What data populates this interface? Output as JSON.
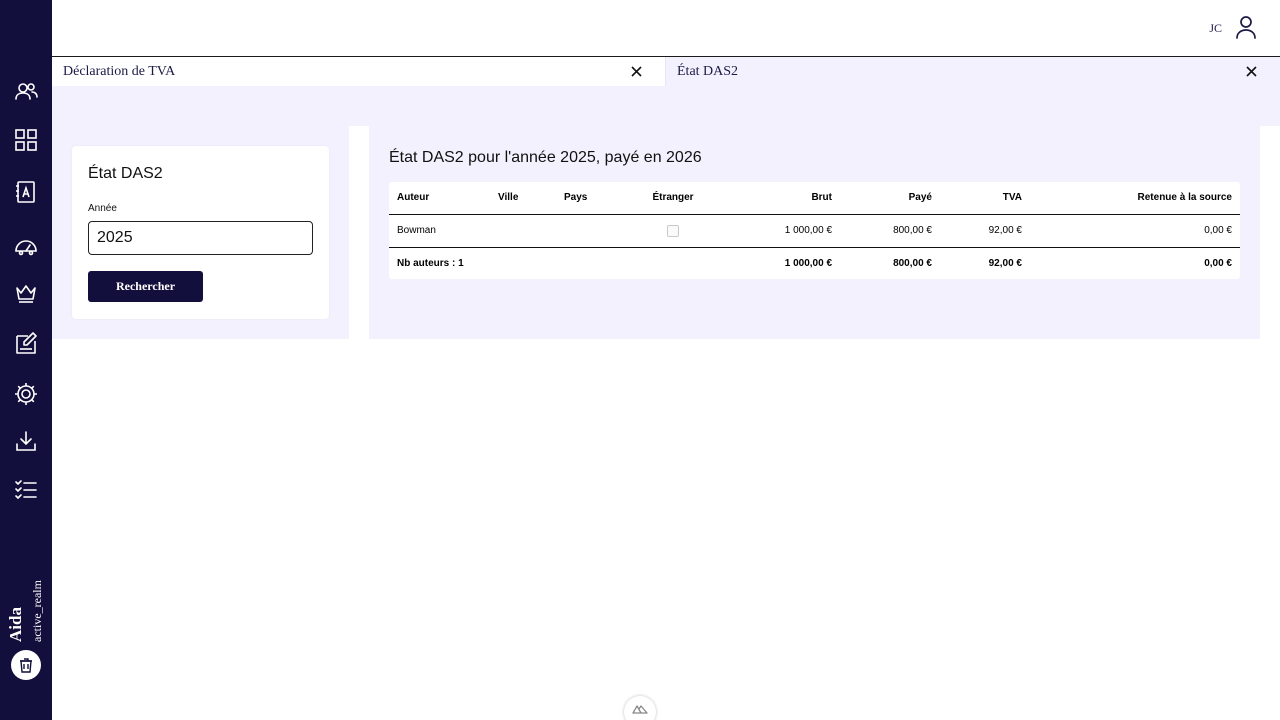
{
  "app": {
    "brand_name": "Aida",
    "realm": "active_realm"
  },
  "header": {
    "user_initials": "JC"
  },
  "sidebar": {
    "icons": [
      "users-icon",
      "dashboard-grid-icon",
      "contacts-book-icon",
      "gauge-icon",
      "crown-icon",
      "edit-document-icon",
      "gear-icon",
      "download-icon",
      "checklist-icon"
    ],
    "bottom_icon": "bin-icon"
  },
  "tabs": [
    {
      "label": "Déclaration de TVA"
    },
    {
      "label": "État DAS2"
    }
  ],
  "form": {
    "title": "État DAS2",
    "year_label": "Année",
    "year_value": "2025",
    "search_label": "Rechercher"
  },
  "report": {
    "title": "État DAS2 pour l'année 2025, payé en 2026",
    "columns": [
      "Auteur",
      "Ville",
      "Pays",
      "Étranger",
      "Brut",
      "Payé",
      "TVA",
      "Retenue à la source"
    ],
    "rows": [
      {
        "auteur": "Bowman",
        "ville": "",
        "pays": "",
        "etranger": false,
        "brut": "1 000,00 €",
        "paye": "800,00 €",
        "tva": "92,00 €",
        "retenue": "0,00 €"
      }
    ],
    "totals": {
      "label": "Nb auteurs : 1",
      "brut": "1 000,00 €",
      "paye": "800,00 €",
      "tva": "92,00 €",
      "retenue": "0,00 €"
    }
  },
  "colors": {
    "sidebar": "#130f3c",
    "panel_bg": "#f3f1fd",
    "accent": "#130f3c"
  }
}
